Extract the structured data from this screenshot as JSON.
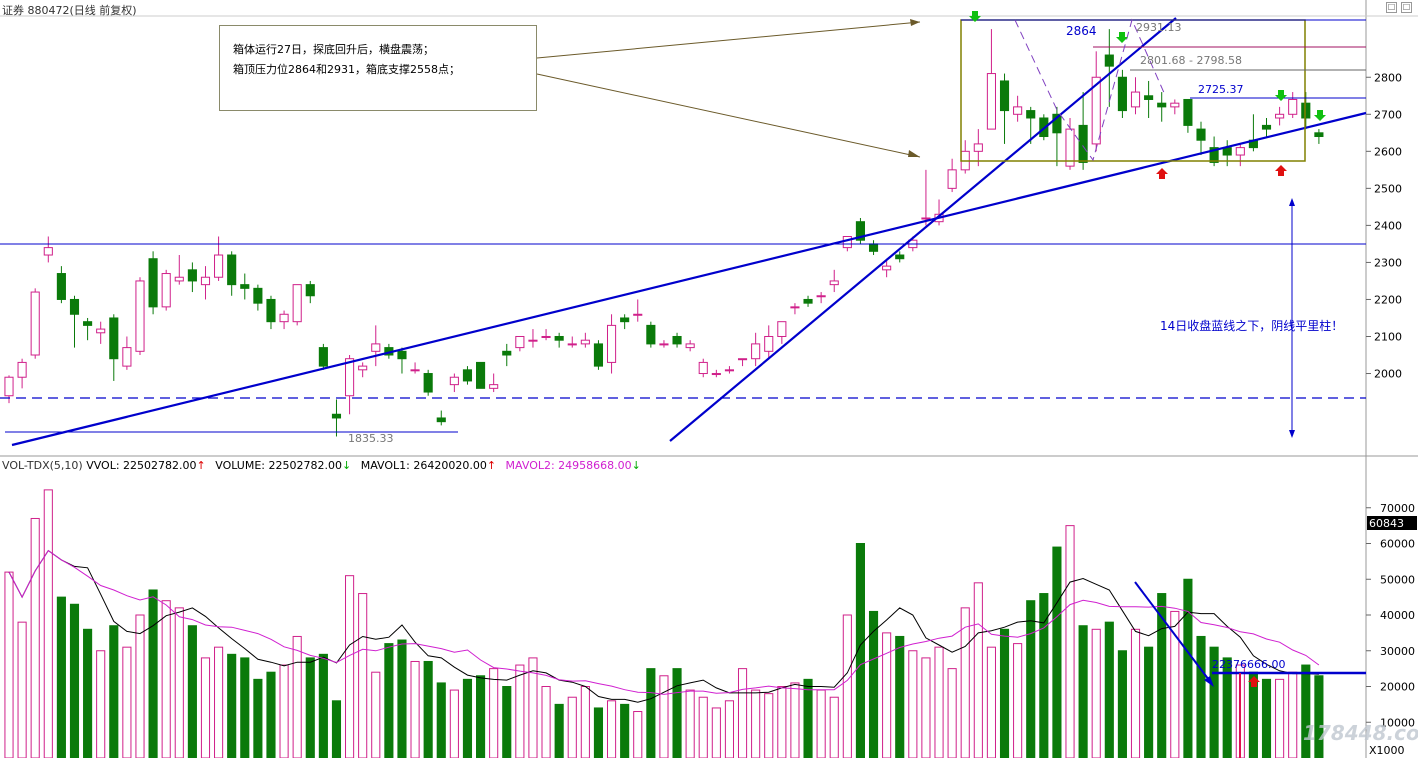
{
  "header": {
    "title": "证券 880472(日线 前复权)"
  },
  "window_buttons": [
    "□",
    "□"
  ],
  "annotations": {
    "box_note_line1": "箱体运行27日，探底回升后，横盘震荡；",
    "box_note_line2": "箱顶压力位2864和2931，箱底支撑2558点；",
    "right_note": "14日收盘蓝线之下，阴线平里柱！",
    "low_label": "1835.33",
    "level_2864": "2864",
    "level_2931": "2931.13",
    "level_2801": "2801.68 - 2798.58",
    "level_2725": "2725.37",
    "vol_level": "22376666.00",
    "last_vol_badge": "60843",
    "vol_unit": "X1000",
    "watermark": "178448.com"
  },
  "volume_panel": {
    "label_name": "VOL-TDX(5,10)",
    "label_vvol": "VVOL: 22502782.00",
    "label_volume": "VOLUME: 22502782.00",
    "label_mavol1": "MAVOL1: 26420020.00",
    "label_mavol2": "MAVOL2: 24958668.00"
  },
  "colors": {
    "up": "#d0208a",
    "down": "#0a7a0a",
    "trend": "#0000cc",
    "ma1": "#000000",
    "ma2": "#d020d0",
    "box": "#808000",
    "grid": "#cccccc"
  },
  "chart_data": [
    {
      "type": "candlestick",
      "title": "880472 日线 前复权",
      "ylim": [
        1780,
        2960
      ],
      "yticks": [
        2000,
        2100,
        2200,
        2300,
        2400,
        2500,
        2600,
        2700,
        2800
      ],
      "candles": [
        [
          1940,
          1990,
          1920,
          1995
        ],
        [
          1990,
          2030,
          1960,
          2040
        ],
        [
          2050,
          2220,
          2040,
          2230
        ],
        [
          2320,
          2340,
          2300,
          2370
        ],
        [
          2270,
          2200,
          2190,
          2290
        ],
        [
          2200,
          2160,
          2070,
          2210
        ],
        [
          2140,
          2130,
          2090,
          2150
        ],
        [
          2110,
          2120,
          2080,
          2140
        ],
        [
          2150,
          2040,
          1980,
          2160
        ],
        [
          2020,
          2070,
          2010,
          2100
        ],
        [
          2060,
          2250,
          2050,
          2260
        ],
        [
          2310,
          2180,
          2160,
          2330
        ],
        [
          2180,
          2270,
          2170,
          2280
        ],
        [
          2250,
          2260,
          2240,
          2320
        ],
        [
          2280,
          2250,
          2220,
          2300
        ],
        [
          2240,
          2260,
          2200,
          2290
        ],
        [
          2260,
          2320,
          2250,
          2370
        ],
        [
          2320,
          2240,
          2210,
          2330
        ],
        [
          2240,
          2230,
          2200,
          2270
        ],
        [
          2230,
          2190,
          2170,
          2240
        ],
        [
          2200,
          2140,
          2120,
          2210
        ],
        [
          2140,
          2160,
          2120,
          2170
        ],
        [
          2140,
          2240,
          2130,
          2240
        ],
        [
          2240,
          2210,
          2190,
          2250
        ],
        [
          2070,
          2020,
          2010,
          2080
        ],
        [
          1890,
          1880,
          1830,
          1930
        ],
        [
          1940,
          2040,
          1890,
          2050
        ],
        [
          2010,
          2020,
          1990,
          2030
        ],
        [
          2060,
          2080,
          2020,
          2130
        ],
        [
          2070,
          2050,
          2040,
          2080
        ],
        [
          2060,
          2040,
          2000,
          2070
        ],
        [
          2010,
          2010,
          2000,
          2030
        ],
        [
          2000,
          1950,
          1940,
          2010
        ],
        [
          1880,
          1870,
          1860,
          1900
        ],
        [
          1970,
          1990,
          1950,
          2000
        ],
        [
          2010,
          1980,
          1970,
          2020
        ],
        [
          2030,
          1960,
          1960,
          2030
        ],
        [
          1960,
          1970,
          1950,
          2000
        ],
        [
          2060,
          2050,
          2020,
          2080
        ],
        [
          2070,
          2100,
          2060,
          2100
        ],
        [
          2090,
          2090,
          2070,
          2120
        ],
        [
          2100,
          2100,
          2090,
          2120
        ],
        [
          2100,
          2090,
          2070,
          2110
        ],
        [
          2080,
          2080,
          2070,
          2100
        ],
        [
          2080,
          2090,
          2070,
          2110
        ],
        [
          2080,
          2020,
          2010,
          2090
        ],
        [
          2030,
          2130,
          2000,
          2160
        ],
        [
          2150,
          2140,
          2120,
          2160
        ],
        [
          2160,
          2160,
          2140,
          2200
        ],
        [
          2130,
          2080,
          2070,
          2140
        ],
        [
          2080,
          2080,
          2070,
          2090
        ],
        [
          2100,
          2080,
          2070,
          2110
        ],
        [
          2070,
          2080,
          2060,
          2090
        ],
        [
          2000,
          2030,
          1990,
          2040
        ],
        [
          2000,
          2000,
          1990,
          2010
        ],
        [
          2010,
          2010,
          2000,
          2020
        ],
        [
          2040,
          2040,
          2020,
          2040
        ],
        [
          2040,
          2080,
          2020,
          2110
        ],
        [
          2060,
          2100,
          2040,
          2130
        ],
        [
          2100,
          2140,
          2080,
          2140
        ],
        [
          2180,
          2180,
          2160,
          2190
        ],
        [
          2200,
          2190,
          2180,
          2210
        ],
        [
          2210,
          2210,
          2190,
          2220
        ],
        [
          2240,
          2250,
          2220,
          2280
        ],
        [
          2340,
          2370,
          2330,
          2370
        ],
        [
          2410,
          2360,
          2350,
          2420
        ],
        [
          2350,
          2330,
          2320,
          2360
        ],
        [
          2280,
          2290,
          2260,
          2310
        ],
        [
          2320,
          2310,
          2300,
          2330
        ],
        [
          2340,
          2360,
          2330,
          2370
        ],
        [
          2420,
          2420,
          2400,
          2550
        ],
        [
          2410,
          2430,
          2400,
          2470
        ],
        [
          2500,
          2550,
          2490,
          2580
        ],
        [
          2550,
          2600,
          2540,
          2630
        ],
        [
          2600,
          2620,
          2560,
          2660
        ],
        [
          2660,
          2810,
          2660,
          2930
        ],
        [
          2790,
          2710,
          2620,
          2810
        ],
        [
          2700,
          2720,
          2680,
          2750
        ],
        [
          2710,
          2690,
          2620,
          2720
        ],
        [
          2690,
          2640,
          2630,
          2700
        ],
        [
          2700,
          2650,
          2560,
          2720
        ],
        [
          2560,
          2660,
          2550,
          2690
        ],
        [
          2670,
          2570,
          2550,
          2760
        ],
        [
          2620,
          2800,
          2600,
          2870
        ],
        [
          2860,
          2830,
          2720,
          2930
        ],
        [
          2800,
          2710,
          2690,
          2820
        ],
        [
          2720,
          2760,
          2700,
          2800
        ],
        [
          2750,
          2740,
          2690,
          2790
        ],
        [
          2730,
          2720,
          2680,
          2760
        ],
        [
          2720,
          2730,
          2700,
          2740
        ],
        [
          2740,
          2670,
          2650,
          2740
        ],
        [
          2660,
          2630,
          2590,
          2680
        ],
        [
          2610,
          2570,
          2560,
          2640
        ],
        [
          2610,
          2590,
          2560,
          2630
        ],
        [
          2590,
          2610,
          2560,
          2620
        ],
        [
          2630,
          2610,
          2600,
          2700
        ],
        [
          2670,
          2660,
          2640,
          2690
        ],
        [
          2690,
          2700,
          2670,
          2720
        ],
        [
          2700,
          2740,
          2690,
          2760
        ],
        [
          2730,
          2690,
          2660,
          2760
        ],
        [
          2650,
          2640,
          2620,
          2660
        ]
      ],
      "trendlines": [
        "support rising line",
        "steep rising line",
        "box top",
        "box bottom"
      ]
    },
    {
      "type": "bar",
      "title": "VOL-TDX(5,10)",
      "unit": "X1000",
      "ylim": [
        0,
        80000
      ],
      "yticks": [
        10000,
        20000,
        30000,
        40000,
        50000,
        60000,
        70000
      ],
      "series": [
        {
          "name": "VOLUME",
          "values": [
            52000,
            38000,
            67000,
            75000,
            45000,
            43000,
            36000,
            30000,
            37000,
            31000,
            40000,
            47000,
            44000,
            42000,
            37000,
            28000,
            31000,
            29000,
            28000,
            22000,
            24000,
            26000,
            34000,
            28000,
            29000,
            16000,
            51000,
            46000,
            24000,
            32000,
            33000,
            27000,
            27000,
            21000,
            19000,
            22000,
            23000,
            25000,
            20000,
            26000,
            28000,
            20000,
            15000,
            17000,
            20000,
            14000,
            16000,
            15000,
            13000,
            25000,
            23000,
            25000,
            19000,
            17000,
            14000,
            16000,
            25000,
            19000,
            18000,
            20000,
            21000,
            22000,
            19000,
            17000,
            40000,
            60000,
            41000,
            35000,
            34000,
            30000,
            28000,
            31000,
            25000,
            42000,
            49000,
            31000,
            36000,
            32000,
            44000,
            46000,
            59000,
            65000,
            37000,
            36000,
            38000,
            30000,
            36000,
            31000,
            46000,
            41000,
            50000,
            34000,
            31000,
            28000,
            26000,
            24000,
            22000,
            22000,
            24000,
            26000,
            23000,
            25000,
            22000
          ]
        },
        {
          "name": "MAVOL1",
          "values": [
            64000,
            58000,
            55000,
            52000,
            47000
          ]
        },
        {
          "name": "MAVOL2",
          "values": [
            60000,
            58000,
            56000,
            54000,
            52000
          ]
        }
      ]
    }
  ]
}
